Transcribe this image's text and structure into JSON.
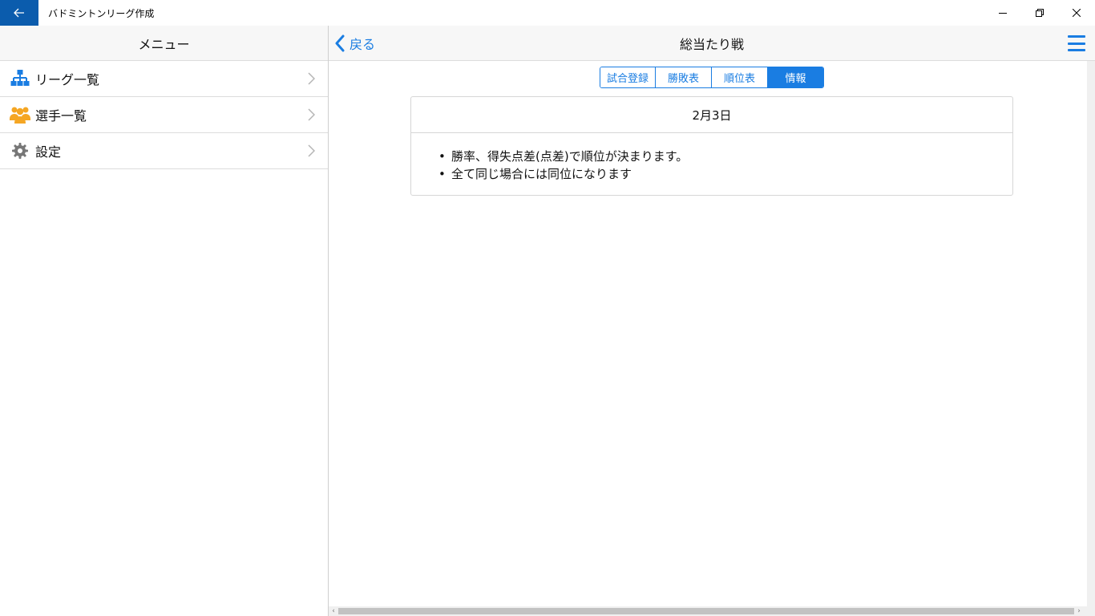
{
  "window": {
    "title": "バドミントンリーグ作成",
    "accent_color": "#0b5cad"
  },
  "sidebar": {
    "header": "メニュー",
    "items": [
      {
        "label": "リーグ一覧",
        "icon": "sitemap-icon",
        "icon_color": "#1a7de2"
      },
      {
        "label": "選手一覧",
        "icon": "users-icon",
        "icon_color": "#f5a623"
      },
      {
        "label": "設定",
        "icon": "gear-icon",
        "icon_color": "#777777"
      }
    ]
  },
  "main": {
    "back_label": "戻る",
    "title": "総当たり戦",
    "accent_color": "#1a7de2",
    "tabs": [
      {
        "label": "試合登録",
        "active": false
      },
      {
        "label": "勝敗表",
        "active": false
      },
      {
        "label": "順位表",
        "active": false
      },
      {
        "label": "情報",
        "active": true
      }
    ],
    "card": {
      "date": "2月3日",
      "bullets": [
        "勝率、得失点差(点差)で順位が決まります。",
        "全て同じ場合には同位になります"
      ]
    }
  }
}
